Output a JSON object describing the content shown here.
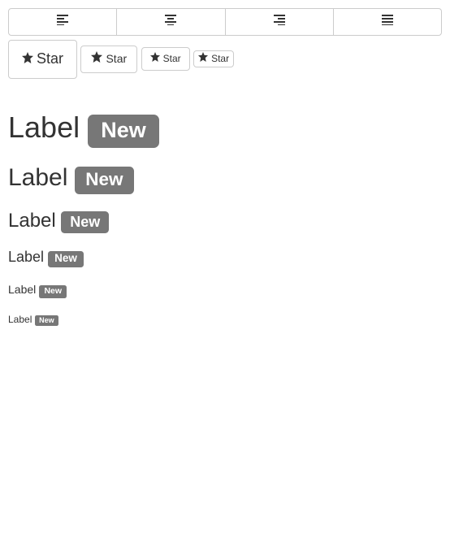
{
  "toolbar": {
    "align_buttons": [
      {
        "name": "align-left-button",
        "icon": "align-left-icon"
      },
      {
        "name": "align-center-button",
        "icon": "align-center-icon"
      },
      {
        "name": "align-right-button",
        "icon": "align-right-icon"
      },
      {
        "name": "align-justify-button",
        "icon": "align-justify-icon"
      }
    ],
    "star_buttons": {
      "lg": {
        "label": "Star"
      },
      "md": {
        "label": "Star"
      },
      "sm": {
        "label": "Star"
      },
      "xs": {
        "label": "Star"
      }
    }
  },
  "labels": {
    "h1": {
      "text": "Label",
      "badge": "New"
    },
    "h2": {
      "text": "Label",
      "badge": "New"
    },
    "h3": {
      "text": "Label",
      "badge": "New"
    },
    "h4": {
      "text": "Label",
      "badge": "New"
    },
    "h5": {
      "text": "Label",
      "badge": "New"
    },
    "h6": {
      "text": "Label",
      "badge": "New"
    }
  }
}
